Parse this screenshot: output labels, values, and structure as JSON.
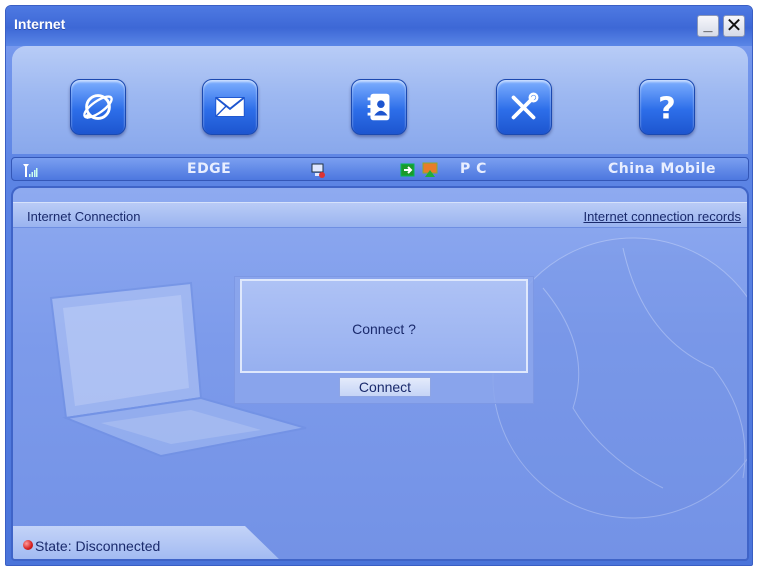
{
  "window": {
    "title": "Internet",
    "minimize_label": "_",
    "close_label": "✕"
  },
  "toolbar": {
    "items": [
      {
        "icon": "internet-globe-icon"
      },
      {
        "icon": "mail-envelope-icon"
      },
      {
        "icon": "contacts-book-icon"
      },
      {
        "icon": "tools-settings-icon"
      },
      {
        "icon": "help-question-icon"
      }
    ]
  },
  "status_bar": {
    "network_type": "EDGE",
    "connection_mode": "P C",
    "operator": "China Mobile"
  },
  "panel": {
    "title": "Internet Connection",
    "records_link": "Internet connection records",
    "dialog_message": "Connect ?",
    "connect_button": "Connect"
  },
  "state": {
    "text": "State: Disconnected",
    "color": "#d41d1d"
  },
  "colors": {
    "accent": "#3d68d6",
    "text": "#1a2a6c"
  }
}
